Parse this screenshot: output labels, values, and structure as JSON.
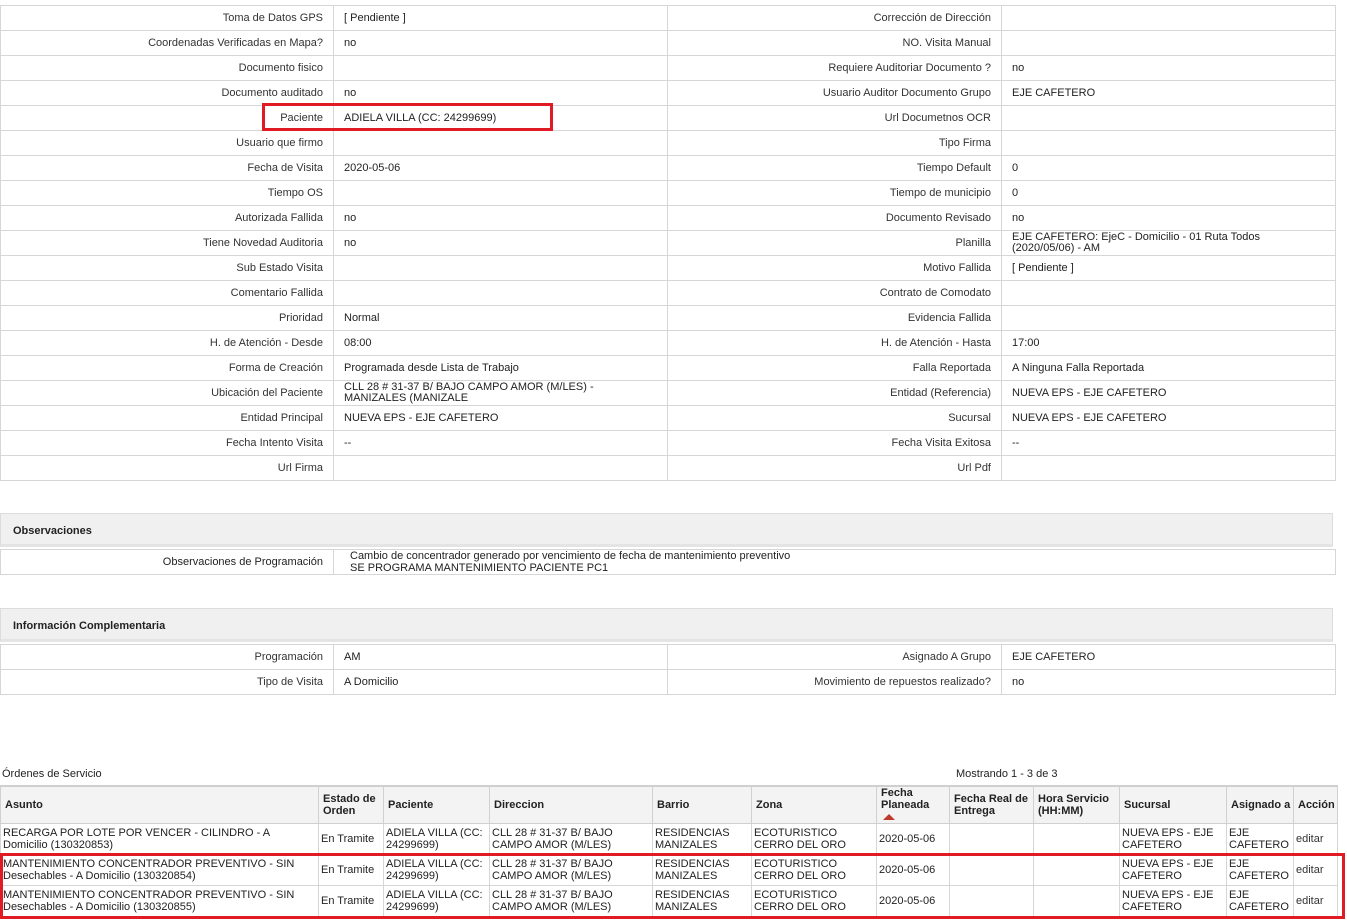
{
  "details": {
    "rows": [
      {
        "l1": "Toma de Datos GPS",
        "v1": "[ Pendiente ]",
        "l2": "Corrección de Dirección",
        "v2": ""
      },
      {
        "l1": "Coordenadas Verificadas en Mapa?",
        "v1": " no",
        "l2": "NO. Visita Manual",
        "v2": ""
      },
      {
        "l1": "Documento fisico",
        "v1": "",
        "l2": "Requiere Auditoriar Documento ?",
        "v2": " no"
      },
      {
        "l1": "Documento auditado",
        "v1": " no",
        "l2": "Usuario Auditor Documento Grupo",
        "v2": "EJE CAFETERO"
      },
      {
        "l1": "Paciente",
        "v1": "ADIELA VILLA (CC: 24299699)",
        "l2": "Url Documetnos OCR",
        "v2": ""
      },
      {
        "l1": "Usuario que firmo",
        "v1": "",
        "l2": "Tipo Firma",
        "v2": ""
      },
      {
        "l1": "Fecha de Visita",
        "v1": " 2020-05-06",
        "l2": "Tiempo Default",
        "v2": "0"
      },
      {
        "l1": "Tiempo OS",
        "v1": "",
        "l2": "Tiempo de municipio",
        "v2": "0"
      },
      {
        "l1": "Autorizada Fallida",
        "v1": " no",
        "l2": "Documento Revisado",
        "v2": " no"
      },
      {
        "l1": "Tiene Novedad Auditoria",
        "v1": " no",
        "l2": "Planilla",
        "v2": "EJE CAFETERO: EjeC - Domicilio - 01 Ruta Todos (2020/05/06) - AM"
      },
      {
        "l1": "Sub Estado Visita",
        "v1": "",
        "l2": "Motivo Fallida",
        "v2": "[ Pendiente ]"
      },
      {
        "l1": "Comentario Fallida",
        "v1": "",
        "l2": "Contrato de Comodato",
        "v2": ""
      },
      {
        "l1": "Prioridad",
        "v1": "Normal",
        "l2": "Evidencia Fallida",
        "v2": ""
      },
      {
        "l1": "H. de Atención - Desde",
        "v1": "08:00",
        "l2": "H. de Atención - Hasta",
        "v2": "17:00"
      },
      {
        "l1": "Forma de Creación",
        "v1": "Programada desde Lista de Trabajo",
        "l2": "Falla Reportada",
        "v2": "A Ninguna Falla Reportada"
      },
      {
        "l1": "Ubicación del Paciente",
        "v1": "CLL 28 # 31-37 B/ BAJO CAMPO AMOR (M/LES) - MANIZALES (MANIZALE",
        "l2": "Entidad (Referencia)",
        "v2": "NUEVA EPS - EJE CAFETERO"
      },
      {
        "l1": "Entidad Principal",
        "v1": "NUEVA EPS - EJE CAFETERO",
        "l2": "Sucursal",
        "v2": "NUEVA EPS - EJE CAFETERO"
      },
      {
        "l1": "Fecha Intento Visita",
        "v1": " --",
        "l2": "Fecha Visita Exitosa",
        "v2": " --"
      },
      {
        "l1": "Url Firma",
        "v1": "",
        "l2": "Url Pdf",
        "v2": ""
      }
    ]
  },
  "observaciones": {
    "title": "Observaciones",
    "label": "Observaciones de Programación",
    "line1": "Cambio de concentrador generado por vencimiento de fecha de mantenimiento preventivo",
    "line2": "SE PROGRAMA MANTENIMIENTO PACIENTE PC1"
  },
  "complementaria": {
    "title": "Información Complementaria",
    "rows": [
      {
        "l1": "Programación",
        "v1": "AM",
        "l2": "Asignado A Grupo",
        "v2": "EJE CAFETERO"
      },
      {
        "l1": "Tipo de Visita",
        "v1": "A Domicilio",
        "l2": "Movimiento de repuestos realizado?",
        "v2": " no"
      }
    ]
  },
  "orders": {
    "title": "Órdenes de Servicio",
    "count": "Mostrando 1 - 3 de 3",
    "headers": [
      "Asunto",
      "Estado de Orden",
      "Paciente",
      "Direccion",
      "Barrio",
      "Zona",
      "Fecha Planeada",
      "Fecha Real de Entrega",
      "Hora Servicio (HH:MM)",
      "Sucursal",
      "Asignado a",
      "Acción"
    ],
    "rows": [
      {
        "asunto": "RECARGA POR LOTE POR VENCER - CILINDRO - A Domicilio (130320853)",
        "estado": "En Tramite",
        "paciente": "ADIELA VILLA (CC: 24299699)",
        "direccion": "CLL 28 # 31-37 B/ BAJO CAMPO AMOR (M/LES)",
        "barrio": "RESIDENCIAS MANIZALES",
        "zona": "ECOTURISTICO CERRO DEL ORO",
        "fecha": "2020-05-06",
        "real": "",
        "hora": "",
        "sucursal": "NUEVA EPS - EJE CAFETERO",
        "asignado": "EJE CAFETERO",
        "accion": "editar"
      },
      {
        "asunto": "MANTENIMIENTO CONCENTRADOR PREVENTIVO - SIN Desechables - A Domicilio (130320854)",
        "estado": "En Tramite",
        "paciente": "ADIELA VILLA (CC: 24299699)",
        "direccion": "CLL 28 # 31-37 B/ BAJO CAMPO AMOR (M/LES)",
        "barrio": "RESIDENCIAS MANIZALES",
        "zona": "ECOTURISTICO CERRO DEL ORO",
        "fecha": "2020-05-06",
        "real": "",
        "hora": "",
        "sucursal": "NUEVA EPS - EJE CAFETERO",
        "asignado": "EJE CAFETERO",
        "accion": "editar"
      },
      {
        "asunto": "MANTENIMIENTO CONCENTRADOR PREVENTIVO - SIN Desechables - A Domicilio (130320855)",
        "estado": "En Tramite",
        "paciente": "ADIELA VILLA (CC: 24299699)",
        "direccion": "CLL 28 # 31-37 B/ BAJO CAMPO AMOR (M/LES)",
        "barrio": "RESIDENCIAS MANIZALES",
        "zona": "ECOTURISTICO CERRO DEL ORO",
        "fecha": "2020-05-06",
        "real": "",
        "hora": "",
        "sucursal": "NUEVA EPS - EJE CAFETERO",
        "asignado": "EJE CAFETERO",
        "accion": "editar"
      }
    ]
  },
  "colors": {
    "highlight": "#e01b24",
    "sort_arrow": "#c0392b"
  }
}
